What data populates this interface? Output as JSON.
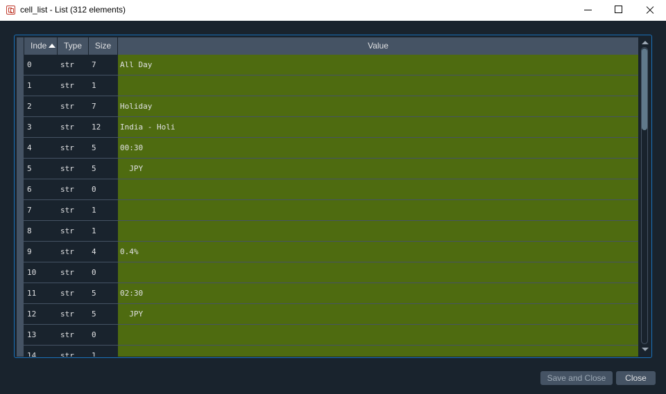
{
  "window": {
    "title": "cell_list - List (312 elements)",
    "controls": [
      "minimize",
      "maximize",
      "close"
    ]
  },
  "table": {
    "columns": {
      "index": "Inde",
      "type": "Type",
      "size": "Size",
      "value": "Value"
    },
    "sort": {
      "column": "index",
      "direction": "ascending"
    },
    "value_color": "#4e6b10",
    "rows": [
      {
        "index": "0",
        "type": "str",
        "size": "7",
        "value": "All Day"
      },
      {
        "index": "1",
        "type": "str",
        "size": "1",
        "value": ""
      },
      {
        "index": "2",
        "type": "str",
        "size": "7",
        "value": "Holiday"
      },
      {
        "index": "3",
        "type": "str",
        "size": "12",
        "value": "India - Holi"
      },
      {
        "index": "4",
        "type": "str",
        "size": "5",
        "value": "00:30"
      },
      {
        "index": "5",
        "type": "str",
        "size": "5",
        "value": "  JPY"
      },
      {
        "index": "6",
        "type": "str",
        "size": "0",
        "value": ""
      },
      {
        "index": "7",
        "type": "str",
        "size": "1",
        "value": ""
      },
      {
        "index": "8",
        "type": "str",
        "size": "1",
        "value": ""
      },
      {
        "index": "9",
        "type": "str",
        "size": "4",
        "value": "0.4%"
      },
      {
        "index": "10",
        "type": "str",
        "size": "0",
        "value": ""
      },
      {
        "index": "11",
        "type": "str",
        "size": "5",
        "value": "02:30"
      },
      {
        "index": "12",
        "type": "str",
        "size": "5",
        "value": "  JPY"
      },
      {
        "index": "13",
        "type": "str",
        "size": "0",
        "value": ""
      },
      {
        "index": "14",
        "type": "str",
        "size": "1",
        "value": ""
      }
    ]
  },
  "buttons": {
    "save_and_close": "Save and Close",
    "close": "Close"
  }
}
